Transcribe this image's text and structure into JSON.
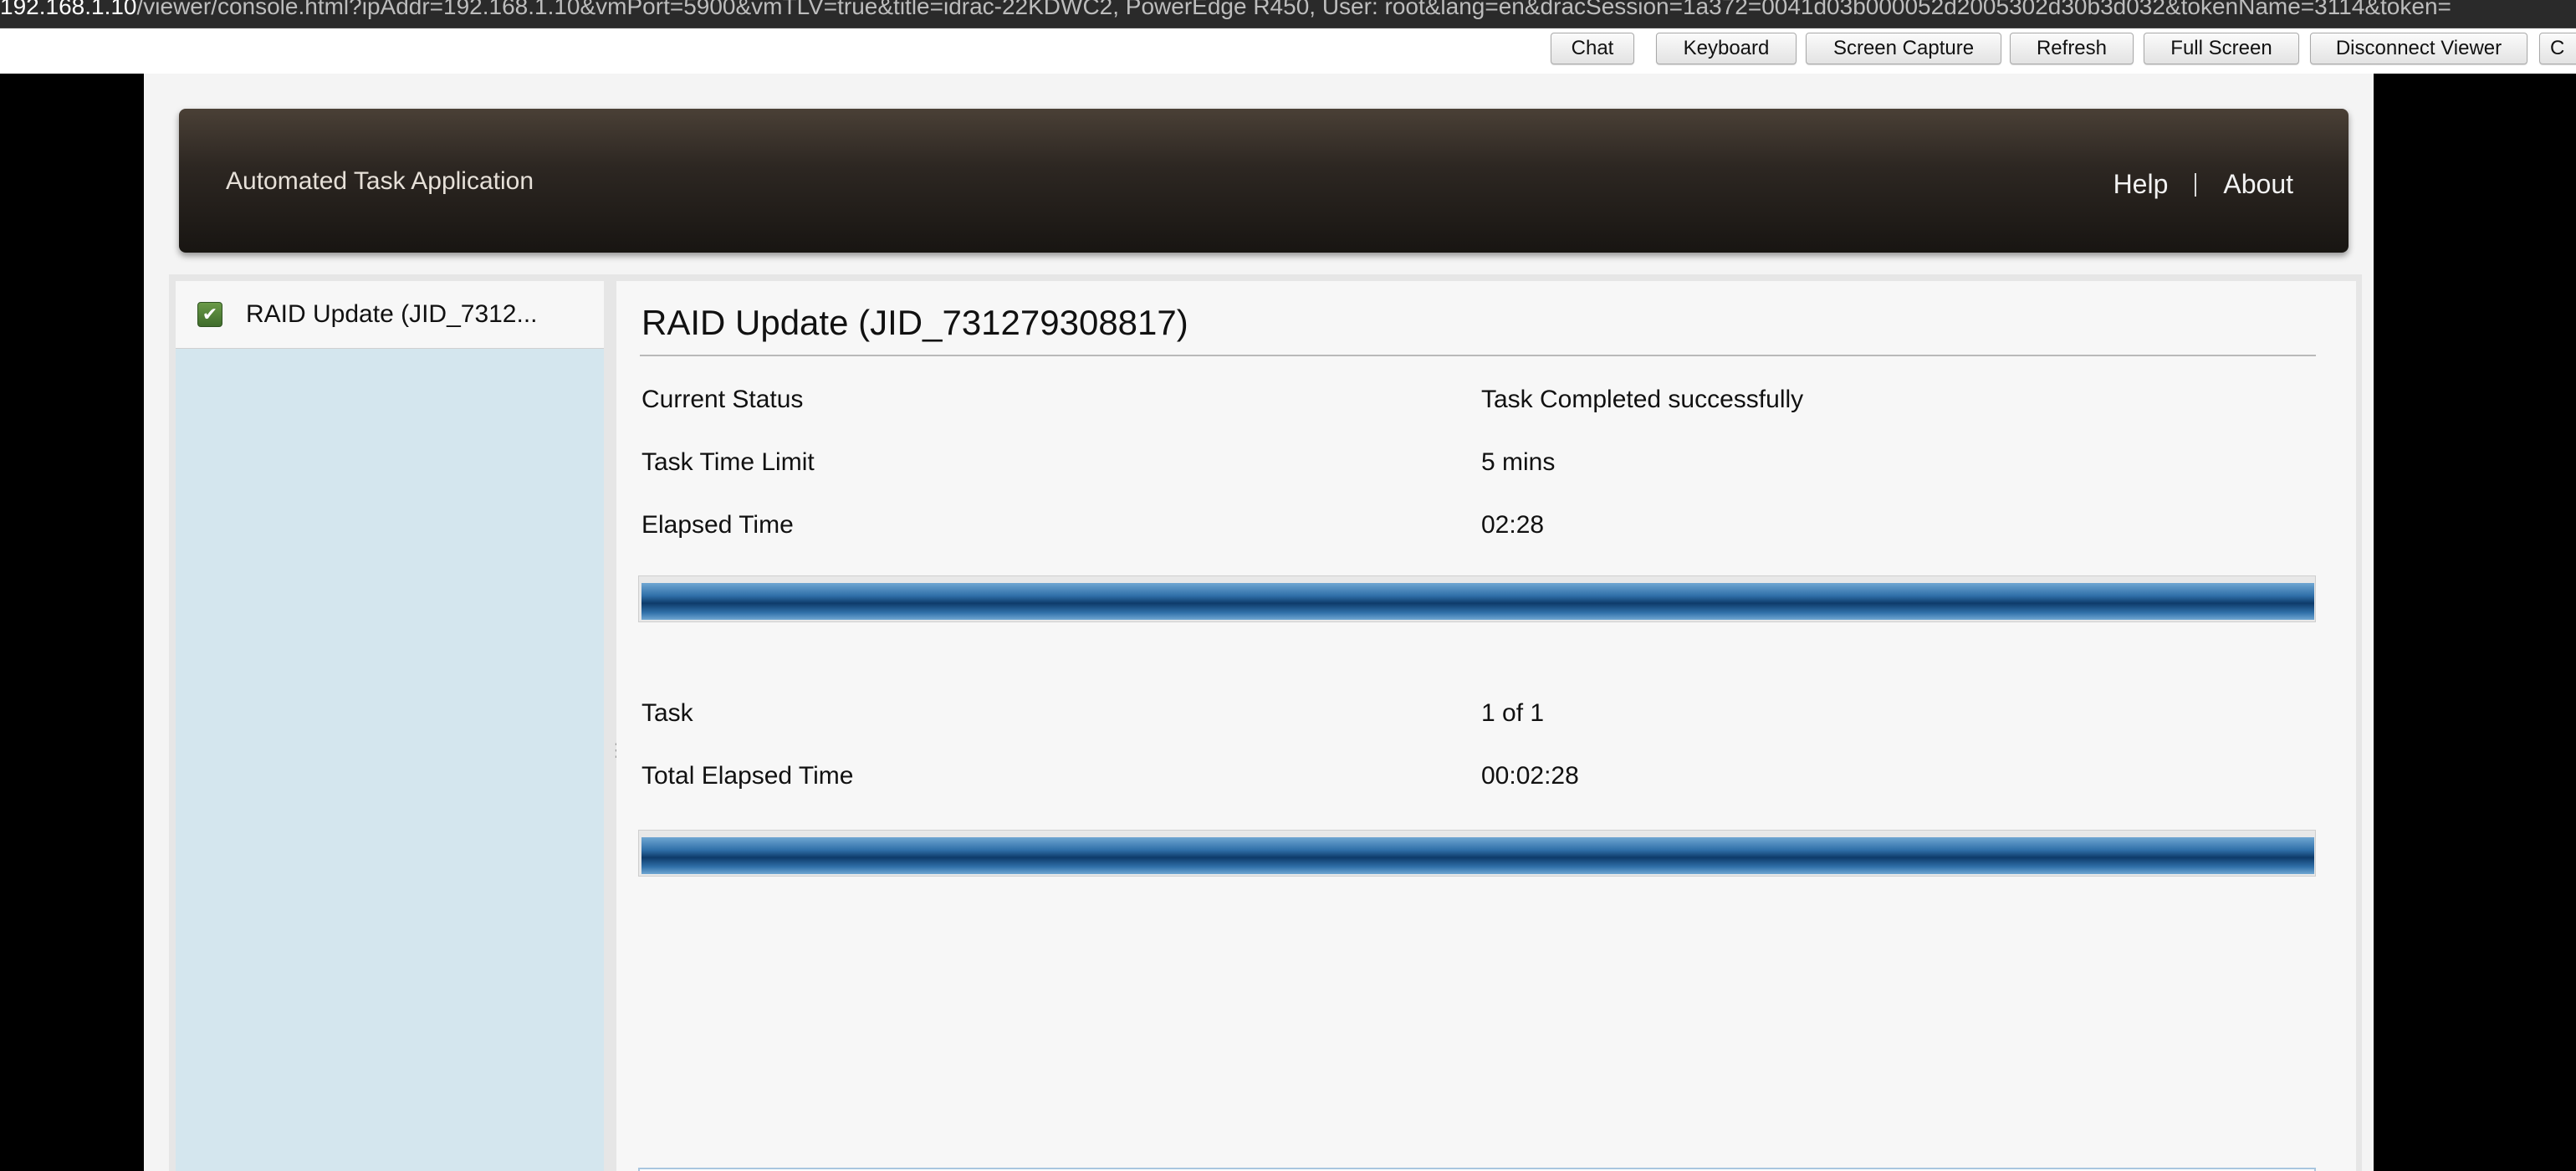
{
  "browser": {
    "url_host": "192.168.1.10",
    "url_rest": "/viewer/console.html?ipAddr=192.168.1.10&vmPort=5900&vmTLV=true&title=idrac-22KDWC2, PowerEdge R450, User: root&lang=en&dracSession=1a372=0041d03b000052d2005302d30b3d032&tokenName=3114&token="
  },
  "toolbar": {
    "buttons": [
      {
        "label": "Chat"
      },
      {
        "label": "Keyboard"
      },
      {
        "label": "Screen Capture"
      },
      {
        "label": "Refresh"
      },
      {
        "label": "Full Screen"
      },
      {
        "label": "Disconnect Viewer"
      },
      {
        "label": "C"
      }
    ]
  },
  "header": {
    "app_title": "Automated Task Application",
    "nav": {
      "help": "Help",
      "about": "About"
    }
  },
  "sidebar": {
    "items": [
      {
        "label": "RAID Update (JID_7312...",
        "icon": "check-icon",
        "status_color": "#4a7d34"
      }
    ]
  },
  "main": {
    "title": "RAID Update (JID_731279308817)",
    "current_status": {
      "label": "Current Status",
      "value": "Task Completed successfully"
    },
    "time_limit": {
      "label": "Task Time Limit",
      "value": "5 mins"
    },
    "elapsed": {
      "label": "Elapsed Time",
      "value": "02:28"
    },
    "task_progress_percent": 100,
    "task": {
      "label": "Task",
      "value": "1 of 1"
    },
    "total_elapsed": {
      "label": "Total Elapsed Time",
      "value": "00:02:28"
    },
    "overall_progress_percent": 100
  },
  "colors": {
    "progress_fill": "#1f5c96",
    "header_bg": "#2d2722",
    "sidebar_bg": "#d4e6ee"
  }
}
